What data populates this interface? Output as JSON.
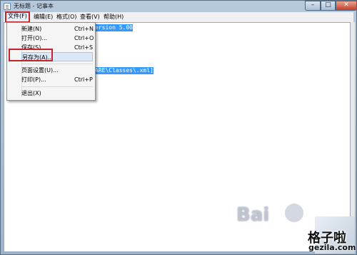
{
  "window": {
    "title": "无标题 - 记事本"
  },
  "controls": {
    "minimize": "–",
    "maximize": "□",
    "close": "✕"
  },
  "menubar": {
    "file": "文件(F)",
    "edit": "编辑(E)",
    "format": "格式(O)",
    "view": "查看(V)",
    "help": "帮助(H)"
  },
  "file_menu": {
    "items": [
      {
        "label": "新建(N)",
        "shortcut": "Ctrl+N"
      },
      {
        "label": "打开(O)...",
        "shortcut": "Ctrl+O"
      },
      {
        "label": "保存(S)",
        "shortcut": "Ctrl+S"
      },
      {
        "label": "另存为(A)...",
        "shortcut": ""
      },
      {
        "label": "页面设置(U)...",
        "shortcut": ""
      },
      {
        "label": "打印(P)...",
        "shortcut": "Ctrl+P"
      },
      {
        "label": "退出(X)",
        "shortcut": ""
      }
    ]
  },
  "editor": {
    "line1": "ersion 5.00",
    "line2": "ARE\\Classes\\.xml]"
  },
  "watermarks": {
    "baidu": "Bai",
    "gezila_cn": "格子啦",
    "gezila_url": "gezila.com"
  },
  "colors": {
    "highlight": "#c0262c",
    "selection": "#3399ff"
  }
}
